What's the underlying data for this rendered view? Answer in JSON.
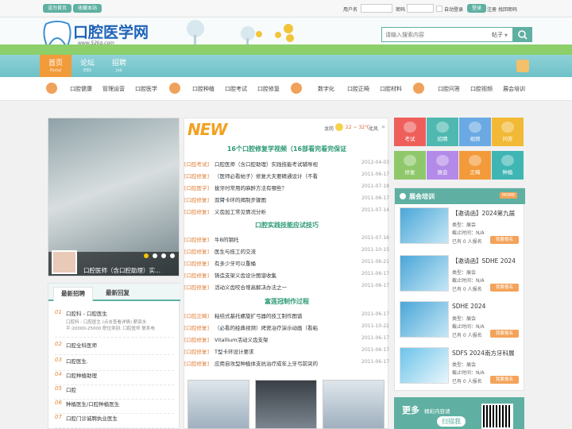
{
  "topbar": {
    "set_home": "设为首页",
    "bookmark": "收藏本站",
    "user_label": "用户名",
    "pass_label": "密码",
    "auto_login": "自动登录",
    "login": "登录",
    "register": "注册",
    "forgot": "找回密码"
  },
  "header": {
    "logo_text": "口腔医学网",
    "logo_url": "www.52kq.com",
    "search_placeholder": "请输入搜索内容",
    "search_scope": "帖子"
  },
  "nav": [
    {
      "label": "首页",
      "sub": "Portal"
    },
    {
      "label": "论坛",
      "sub": "BBS"
    },
    {
      "label": "招聘",
      "sub": "Job"
    }
  ],
  "categories": [
    "口腔健康",
    "管理运营",
    "口腔医学",
    "口腔种植",
    "口腔考试",
    "口腔修复",
    "数字化",
    "口腔正畸",
    "口腔材料",
    "口腔问答",
    "口腔视频",
    "展会培训"
  ],
  "slider": {
    "caption": "口腔医师（含口腔助理）实..."
  },
  "jobs": {
    "tabs": [
      "最新招聘",
      "最新回复"
    ],
    "items": [
      {
        "num": "01",
        "title": "口腔科 - 口腔医生",
        "desc1": "口腔科 - 口腔医生 (点击查看详情) 薪资水",
        "desc2": "平:20000-25000 职位类别: 口腔医师 联系电"
      },
      {
        "num": "02",
        "title": "口腔全科医师"
      },
      {
        "num": "03",
        "title": "口腔医生."
      },
      {
        "num": "04",
        "title": "口腔种植助理"
      },
      {
        "num": "05",
        "title": "口腔"
      },
      {
        "num": "06",
        "title": "种植医生/口腔种植医生"
      },
      {
        "num": "07",
        "title": "口腔门诊诚聘执业医生"
      }
    ]
  },
  "news": {
    "logo": "NEW",
    "weather_city": "龙岗",
    "weather_temp": "22 ~ 32℃",
    "weather_city2": "北风",
    "sections": [
      {
        "title": "16个口腔修复学视频（16部看完看完保证",
        "items": [
          {
            "cat": "[口腔考试]",
            "text": "口腔医师（含口腔助理）实践技能考试辅导视",
            "date": "2012-04-03"
          },
          {
            "cat": "[口腔修复]",
            "text": "（医师必看帖子）修复大夫要精通设计（不看",
            "date": "2011-06-17"
          },
          {
            "cat": "[口腔医学]",
            "text": "拔牙时常用的麻醉方法有哪些？",
            "date": "2011-07-18"
          },
          {
            "cat": "[口腔修复]",
            "text": "双臂卡环的揭制步骤图",
            "date": "2011-06-17"
          },
          {
            "cat": "[口腔修复]",
            "text": "义齿加工常见情况分析",
            "date": "2011-07-14"
          }
        ]
      },
      {
        "title": "口腔实践技能应试技巧",
        "items": [
          {
            "cat": "[口腔修复]",
            "text": "牛B的钢托",
            "date": "2011-07-16"
          },
          {
            "cat": "[口腔修复]",
            "text": "医生与技工的交流",
            "date": "2011-10-15"
          },
          {
            "cat": "[口腔修复]",
            "text": "有多少牙可以重桶",
            "date": "2011-06-21"
          },
          {
            "cat": "[口腔修复]",
            "text": "铸造支架义齿设计图谱收集",
            "date": "2011-06-17"
          },
          {
            "cat": "[口腔修复]",
            "text": "活动义齿咬合增高解决办法之一",
            "date": "2011-06-17"
          }
        ]
      },
      {
        "title": "富莲冠制作过程",
        "items": [
          {
            "cat": "[口腔正畸]",
            "text": "粘结式基托螺旋扩弓器的技工制作图谱",
            "date": "2011-06-17"
          },
          {
            "cat": "[口腔修复]",
            "text": "（必看的经典视频）烤瓷冶疗演示动画（看粘",
            "date": "2011-10-22"
          },
          {
            "cat": "[口腔修复]",
            "text": "Vitallium活动义齿支架",
            "date": "2011-06-17"
          },
          {
            "cat": "[口腔修复]",
            "text": "T型卡环设计要求",
            "date": "2011-06-17"
          },
          {
            "cat": "[口腔修复]",
            "text": "应用自攻型种植体支抗治疗成年上牙弓前突的",
            "date": "2011-06-17"
          }
        ]
      }
    ]
  },
  "tiles": [
    {
      "label": "考试",
      "color": "#ee5f5b"
    },
    {
      "label": "招聘",
      "color": "#4fb8b0"
    },
    {
      "label": "视频",
      "color": "#6aa9e4"
    },
    {
      "label": "问答",
      "color": "#f2b936"
    },
    {
      "label": "修复",
      "color": "#8fc86a"
    },
    {
      "label": "展会",
      "color": "#b48ae8"
    },
    {
      "label": "正畸",
      "color": "#f39a3a"
    },
    {
      "label": "种植",
      "color": "#3fb6b4"
    }
  ],
  "expo": {
    "title": "展会培训",
    "more": "MORE",
    "apply": "我要报名",
    "items": [
      {
        "title": "【邀请函】2024第九届",
        "type": "类型：展会",
        "deadline": "截止时间：N/A",
        "count": "已有 0 人报名"
      },
      {
        "title": "【邀请函】SDHE 2024",
        "type": "类型：展会",
        "deadline": "截止时间：N/A",
        "count": "已有 0 人报名"
      },
      {
        "title": "SDHE 2024",
        "type": "类型：展会",
        "deadline": "截止时间：N/A",
        "count": "已有 0 人报名"
      },
      {
        "title": "SDFS 2024南方牙科展",
        "type": "类型：展会",
        "deadline": "截止时间：N/A",
        "count": "已有 0 人报名"
      }
    ]
  },
  "footer_promo": {
    "more": "更多",
    "sub": "精彩内容请",
    "scan": "扫描我"
  }
}
